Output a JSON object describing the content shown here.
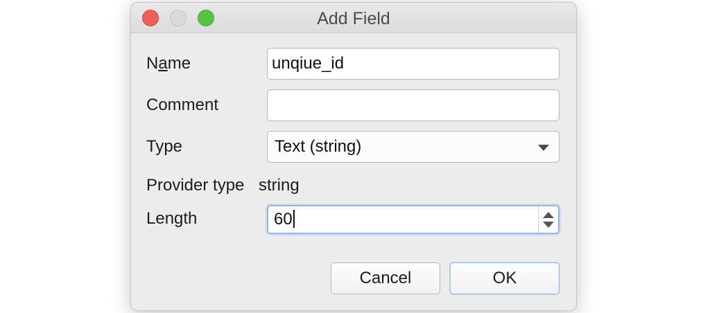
{
  "window": {
    "title": "Add Field"
  },
  "form": {
    "name_label_prefix": "N",
    "name_label_mnemonic": "a",
    "name_label_suffix": "me",
    "name_value": "unqiue_id",
    "comment_label": "Comment",
    "comment_value": "",
    "type_label": "Type",
    "type_value": "Text (string)",
    "provider_type_label": "Provider type",
    "provider_type_value": "string",
    "length_label": "Length",
    "length_value": "60"
  },
  "buttons": {
    "cancel_label": "Cancel",
    "ok_label": "OK"
  },
  "colors": {
    "close": "#ee5f58",
    "minimize": "#d9d9d9",
    "zoom": "#58c146",
    "focus_ring": "#8fb8e8"
  }
}
